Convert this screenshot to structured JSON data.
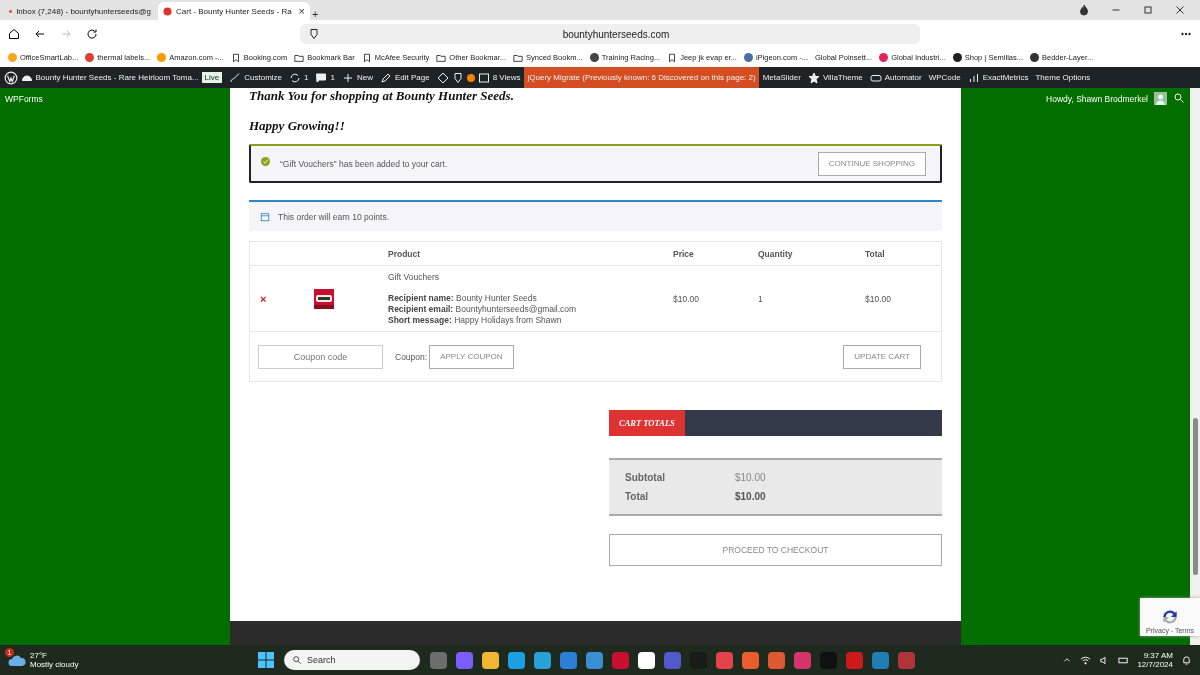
{
  "browser": {
    "tabs": [
      {
        "title": "Inbox (7,248) - bountyhunterseeds@g",
        "selected": false
      },
      {
        "title": "Cart - Bounty Hunter Seeds - Ra",
        "selected": true,
        "close": "×"
      }
    ],
    "new_tab": "+",
    "url": "bountyhunterseeds.com",
    "forward_disabled": true,
    "bookmarks": [
      {
        "label": "OfficeSmartLab...",
        "kind": "site",
        "color": "#f5a623"
      },
      {
        "label": "thermal labels...",
        "kind": "site",
        "color": "#e03c31"
      },
      {
        "label": "Amazon.com -...",
        "kind": "site",
        "color": "#f59b00"
      },
      {
        "label": "Booking.com",
        "kind": "page"
      },
      {
        "label": "Bookmark Bar",
        "kind": "folder"
      },
      {
        "label": "McAfee Security",
        "kind": "page"
      },
      {
        "label": "Other Bookmar...",
        "kind": "folder"
      },
      {
        "label": "Synced Bookm...",
        "kind": "folder"
      },
      {
        "label": "Training Racing...",
        "kind": "site",
        "color": "#444444"
      },
      {
        "label": "Jeep jk evap er...",
        "kind": "page"
      },
      {
        "label": "iPigeon.com -...",
        "kind": "site",
        "color": "#4a6fa5"
      },
      {
        "label": "Global Poinsett...",
        "kind": "plain"
      },
      {
        "label": "Global Industri...",
        "kind": "site",
        "color": "#e0245e"
      },
      {
        "label": "Shop | Semillas...",
        "kind": "site",
        "color": "#222222"
      },
      {
        "label": "Bedder-Layer...",
        "kind": "site",
        "color": "#333333"
      }
    ]
  },
  "admin_bar": {
    "items": [
      {
        "label": "Bounty Hunter Seeds - Rare Heirloom Toma...",
        "badge": "Live",
        "highlighted": false
      },
      {
        "label": "Customize",
        "highlighted": false
      },
      {
        "label": "1",
        "highlighted": false
      },
      {
        "label": "1",
        "highlighted": false
      },
      {
        "label": "New",
        "highlighted": false
      },
      {
        "label": "Edit Page",
        "highlighted": false
      },
      {
        "label": "8 Views",
        "highlighted": false
      },
      {
        "label": "jQuery Migrate (Previously known: 6 Discovered on this page: 2)",
        "highlighted": true
      },
      {
        "label": "MetaSlider",
        "highlighted": false
      },
      {
        "label": "VillaTheme",
        "highlighted": false
      },
      {
        "label": "Automator",
        "highlighted": false
      },
      {
        "label": "WPCode",
        "highlighted": false
      },
      {
        "label": "ExactMetrics",
        "highlighted": false
      },
      {
        "label": "Theme Options",
        "highlighted": false
      }
    ],
    "left_item": "WPForms",
    "greeting": "Howdy, Shawn Brodmerkel"
  },
  "page": {
    "thank_you": "Thank You for shopping at Bounty Hunter Seeds.",
    "happy": "Happy Growing!!",
    "notice": {
      "message": "“Gift Vouchers” has been added to your cart.",
      "button": "CONTINUE SHOPPING"
    },
    "points": "This order will earn 10 points.",
    "cart": {
      "columns": [
        "Product",
        "Price",
        "Quantity",
        "Total"
      ],
      "rows": [
        {
          "remove": "×",
          "name": "Gift Vouchers",
          "meta": [
            "**Recipient name:** Bounty Hunter Seeds",
            "**Recipient email:** Bountyhunterseeds@gmail.com",
            "**Short message:** Happy Holidays from Shawn"
          ],
          "price": "$10.00",
          "quantity": "1",
          "total": "$10.00"
        }
      ],
      "coupon_placeholder": "Coupon code",
      "coupon_label": "Coupon:",
      "apply": "APPLY COUPON",
      "update": "UPDATE CART"
    },
    "totals": {
      "title": "CART TOTALS",
      "rows": [
        {
          "label": "Subtotal",
          "value": "$10.00",
          "kind": "plain"
        },
        {
          "label": "Total",
          "value": "$10.00",
          "kind": "strong"
        }
      ],
      "checkout": "PROCEED TO CHECKOUT"
    },
    "recaptcha": "Privacy - Terms"
  },
  "taskbar": {
    "temperature": "27°F",
    "weather": "Mostly cloudy",
    "weather_badge": "1",
    "search_placeholder": "Search",
    "apps": [
      {
        "color": "#6d6d6d"
      },
      {
        "color": "#7b5cff"
      },
      {
        "color": "#f2b632"
      },
      {
        "color": "#1ba0e1"
      },
      {
        "color": "#2aa0d8"
      },
      {
        "color": "#2b7fd9"
      },
      {
        "color": "#3a8fd4"
      },
      {
        "color": "#c8102e"
      },
      {
        "color": "#ffffff"
      },
      {
        "color": "#5059c9"
      },
      {
        "color": "#1a1a1a"
      },
      {
        "color": "#e4434b"
      },
      {
        "color": "#e85d2a"
      },
      {
        "color": "#de5833"
      },
      {
        "color": "#d6336c"
      },
      {
        "color": "#111111"
      },
      {
        "color": "#cc1a1a"
      },
      {
        "color": "#1f7fb5"
      },
      {
        "color": "#b0353a"
      }
    ],
    "time": "9:37 AM",
    "date": "12/7/2024"
  }
}
